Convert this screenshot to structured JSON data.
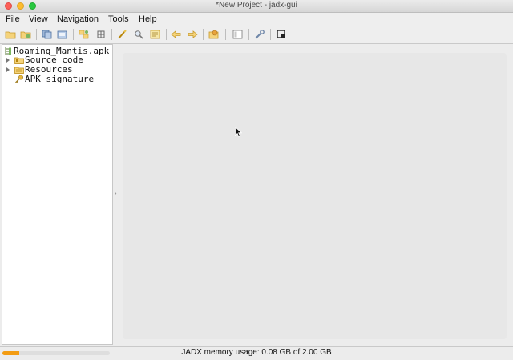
{
  "window": {
    "title": "*New Project - jadx-gui"
  },
  "menu": {
    "file": "File",
    "view": "View",
    "navigation": "Navigation",
    "tools": "Tools",
    "help": "Help"
  },
  "toolbar": {
    "icons": [
      "open-file-icon",
      "add-files-icon",
      "save-all-icon",
      "export-icon",
      "sync-icon",
      "flatten-packages-icon",
      "text-search-icon",
      "class-search-icon",
      "usage-search-icon",
      "back-icon",
      "forward-icon",
      "deobfuscation-icon",
      "log-viewer-icon",
      "preferences-icon",
      "quark-icon"
    ]
  },
  "tree": {
    "root": "Roaming_Mantis.apk",
    "items": [
      {
        "label": "Source code",
        "icon": "package-folder-icon"
      },
      {
        "label": "Resources",
        "icon": "resources-folder-icon"
      },
      {
        "label": "APK signature",
        "icon": "key-icon"
      }
    ]
  },
  "status": {
    "memory_text": "JADX memory usage: 0.08 GB of 2.00 GB",
    "memory_fraction": 0.04
  },
  "colors": {
    "accent": "#f39c12",
    "editor_bg": "#e7e7e7"
  }
}
